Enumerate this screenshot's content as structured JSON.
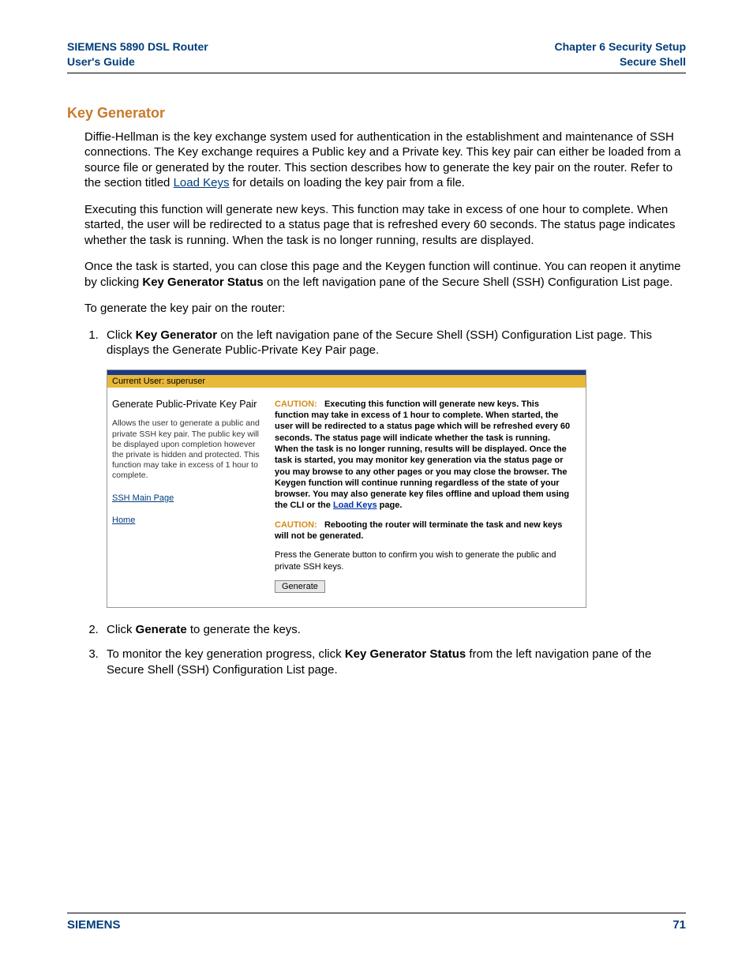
{
  "header": {
    "left_line1": "SIEMENS 5890 DSL Router",
    "left_line2": "User's Guide",
    "right_line1": "Chapter 6  Security Setup",
    "right_line2": "Secure Shell"
  },
  "section_title": "Key Generator",
  "para1_a": "Diffie-Hellman is the key exchange system used for authentication in the establishment and maintenance of SSH connections. The Key exchange requires a Public key and a Private key. This key pair can either be loaded from a source file or generated by the router. This section describes how to generate the key pair on the router. Refer to the section titled ",
  "para1_link": "Load Keys",
  "para1_b": " for details on loading the key pair from a file.",
  "para2": "Executing this function will generate new keys. This function may take in excess of one hour to complete. When started, the user will be redirected to a status page that is refreshed every 60 seconds. The status page indicates whether the task is running. When the task is no longer running, results are displayed.",
  "para3_a": "Once the task is started, you can close this page and the Keygen function will continue. You can reopen it anytime by clicking ",
  "para3_bold": "Key Generator Status",
  "para3_b": " on the left navigation pane of the Secure Shell (SSH) Configuration List page.",
  "para4": "To generate the key pair on the router:",
  "step1_a": "Click ",
  "step1_bold": "Key Generator",
  "step1_b": " on the left navigation pane of the Secure Shell (SSH) Configuration List page. This displays the Generate Public-Private Key Pair page.",
  "step2_a": "Click ",
  "step2_bold": "Generate",
  "step2_b": " to generate the keys.",
  "step3_a": "To monitor the key generation progress, click ",
  "step3_bold": "Key Generator Status",
  "step3_b": " from the left navigation pane of the Secure Shell (SSH) Configuration List page.",
  "screenshot": {
    "userbar": "Current User: superuser",
    "left_title": "Generate Public-Private Key Pair",
    "left_desc": "Allows the user to generate a public and private SSH key pair. The public key will be displayed upon completion however the private is hidden and protected. This function may take in excess of 1 hour to complete.",
    "link1": "SSH Main Page",
    "link2": "Home",
    "caution_label": "CAUTION:",
    "caution1_a": "Executing this function will generate new keys. This function may take in excess of 1 hour to complete. When started, the user will be redirected to a status page which will be refreshed every 60 seconds. The status page will indicate whether the task is running. When the task is no longer running, results will be displayed. Once the task is started, you may monitor key generation via the status page or you may browse to any other pages or you may close the browser. The Keygen function will continue running regardless of the state of your browser. You may also generate key files offline and upload them using the CLI or the ",
    "caution1_link": "Load Keys",
    "caution1_b": " page.",
    "caution2": "Rebooting the router will terminate the task and new keys will not be generated.",
    "press_text": "Press the Generate button to confirm you wish to generate the public and private SSH keys.",
    "button": "Generate"
  },
  "footer": {
    "left": "SIEMENS",
    "right": "71"
  }
}
